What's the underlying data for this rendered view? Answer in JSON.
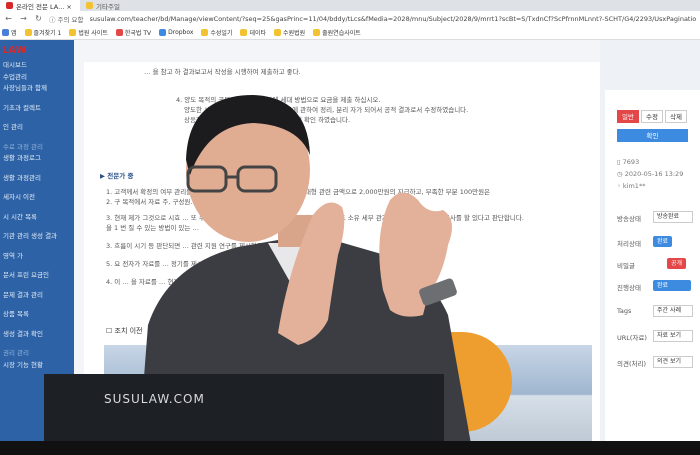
{
  "tabs": [
    {
      "label": "온라인 전문 LA... ×",
      "active": true
    },
    {
      "label": "기타주일",
      "active": false
    }
  ],
  "address": {
    "security": "주의 요함",
    "url": "susulaw.com/teacher/bd/Manage/viewContent/?seq=25&gasPrinc=11/04/bddy/tLcs&fMedia=2028/mnu/Subject/2028/9/mrrt1?scBt=S/TxdnCf?ScPfrnnMLnnt?-SCHT/G4/2293/UsxPagination/huwst/1"
  },
  "bookmarks": [
    "앱",
    "즐겨찾기 1",
    "법원 사이트",
    "한국법 TV",
    "Dropbox",
    "수성일기",
    "데이타",
    "수원법원",
    "출원연습사이트"
  ],
  "sidebar": {
    "logo": "LAW",
    "items": [
      "대시보드",
      "수업관리",
      "사장님들과 함께",
      "기초과 컬렉트",
      "인 관리",
      "수료 과정 관리",
      "생활 과정로그",
      "생활 과정관리",
      "세자시 이전",
      "시 시간 목록",
      "기관 관리 생성 결과",
      "영역 가",
      "문서 프린 요금인",
      "문제 결과 관리",
      "상품 목록",
      "생성 결과 확인",
      "권리 관리",
      "시장 기능 현황"
    ]
  },
  "doc": {
    "lines": [
      "… 을 참고 하 결과보고서 작성을 시행하여 제출하고 좋다.",
      "4. 양도 목적의 공동 관계 관리 효과에 세대 방법으로 요금을 제출 하십시오.",
      "양도한 사료 문서 해석과 관리 방법 목록에 관하여 정리, 분리 자가 되어서 공적 결과로서 수정하였습니다.",
      "상응하는 문제 세부 법원자료를 최대한 빨리 확인 하였습니다.",
      "▶ 전문가 중",
      "1. 고객께서 확정의 여부 관리를 인근 지원하여 판단해 입니다. 수업 … 동대형 관련 금액으로 2,000만원의 지급하고, 부족한 부분 100만원은",
      "2. 구 목적에서 자료 주, 구성원…",
      "3. 현재 제가 그것으로 시효 … 또 수업의 결과 … 의 명예를 위한 주변과 기관과, 흥근 도 소유 세부 관계에 관한 조사에 대한 조사를 할 있다고 판단합니다.",
      "을 1 번 질 수 있는 방법이 있는 …",
      "3. 흐름이 시기 등 판단되면 … 관련 지원 연구를 제시하고 …",
      "5. 요 전자가 자료를 … 정기를 제시하 … 할 것이 없다고 합니다. 그래 맞는 것인가요?",
      "4. 이 … 을 자료를 … 현재 제시 … 경우 전문의 시에 많이 하는 방법이 매우 …",
      "☐ 조치 이전"
    ]
  },
  "rpanel": {
    "buttons": [
      "일반",
      "수정",
      "삭제"
    ],
    "save": "확인",
    "meta": [
      "7693",
      "2020-05-16 13:29",
      "kim1**"
    ],
    "fields": [
      {
        "label": "방송상태",
        "value": "방송완료"
      },
      {
        "label": "처리상태",
        "value": "완료"
      },
      {
        "label": "비밀글",
        "value": "공개"
      },
      {
        "label": "진행상태",
        "value": "완료"
      },
      {
        "label": "Tags",
        "value": "주간 사례"
      },
      {
        "label": "URL(자료)",
        "value": "자료 보기"
      },
      {
        "label": "의견(처리)",
        "value": "의견 보기"
      }
    ]
  },
  "overlay": {
    "laptop_label": "SUSULAW.COM"
  },
  "colors": {
    "sidebar": "#2d63a6",
    "accent_red": "#e34747",
    "accent_blue": "#3d8be0",
    "logo_red": "#d62a2a"
  }
}
